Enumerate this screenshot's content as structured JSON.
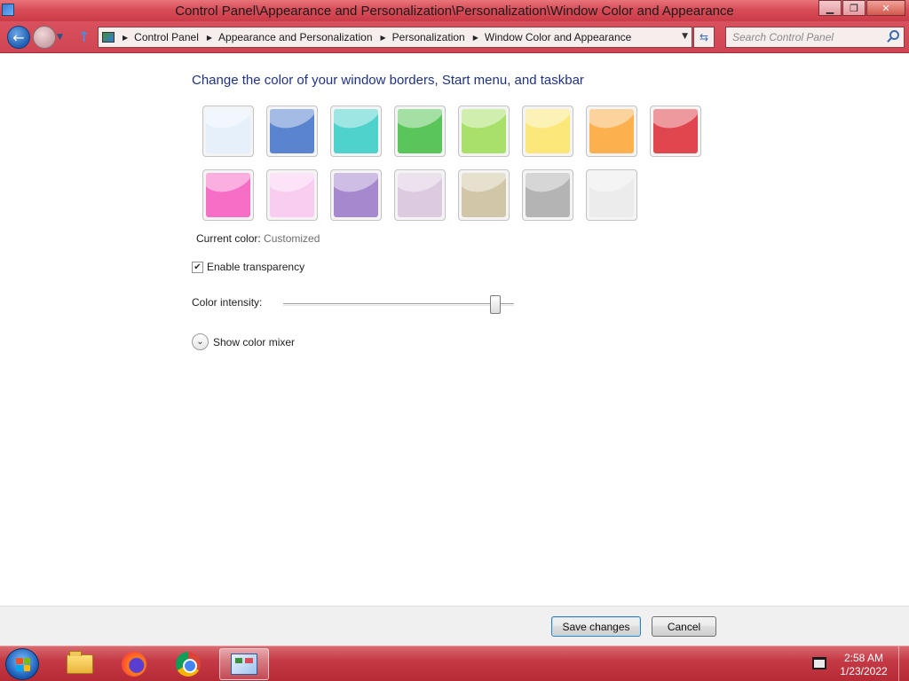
{
  "window": {
    "title": "Control Panel\\Appearance and Personalization\\Personalization\\Window Color and Appearance",
    "minimize": "▁",
    "maximize": "❐",
    "close": "✕"
  },
  "navigation": {
    "breadcrumbs": [
      "Control Panel",
      "Appearance and Personalization",
      "Personalization",
      "Window Color and Appearance"
    ],
    "search_placeholder": "Search Control Panel"
  },
  "content": {
    "heading": "Change the color of your window borders, Start menu, and taskbar",
    "swatches": [
      {
        "name": "sky",
        "color": "#e6f0fb"
      },
      {
        "name": "twilight",
        "color": "#5a84cf"
      },
      {
        "name": "sea",
        "color": "#4fd1cc"
      },
      {
        "name": "leaf",
        "color": "#59c55a"
      },
      {
        "name": "lime",
        "color": "#a9e06a"
      },
      {
        "name": "lemon",
        "color": "#fbe77a"
      },
      {
        "name": "pumpkin",
        "color": "#fcb04e"
      },
      {
        "name": "ruby",
        "color": "#e0464e"
      },
      {
        "name": "fuchsia",
        "color": "#f66ec6"
      },
      {
        "name": "blush",
        "color": "#f9cdf0"
      },
      {
        "name": "violet",
        "color": "#a688cf"
      },
      {
        "name": "lavender",
        "color": "#dccbe0"
      },
      {
        "name": "taupe",
        "color": "#d2c6a8"
      },
      {
        "name": "chocolate",
        "color": "#b4b4b4"
      },
      {
        "name": "slate",
        "color": "#ececec"
      }
    ],
    "current_color_label": "Current color:",
    "current_color_value": "Customized",
    "enable_transparency_label": "Enable transparency",
    "enable_transparency_checked": true,
    "color_intensity_label": "Color intensity:",
    "color_intensity_value": 0.92,
    "show_color_mixer_label": "Show color mixer"
  },
  "footer": {
    "save_label": "Save changes",
    "cancel_label": "Cancel"
  },
  "taskbar": {
    "time": "2:58 AM",
    "date": "1/23/2022",
    "apps": [
      "windows-explorer",
      "firefox",
      "chrome",
      "control-panel"
    ]
  },
  "colors": {
    "titlebar": "#d84c58",
    "heading": "#1e3287",
    "taskbar": "#c43a45"
  }
}
